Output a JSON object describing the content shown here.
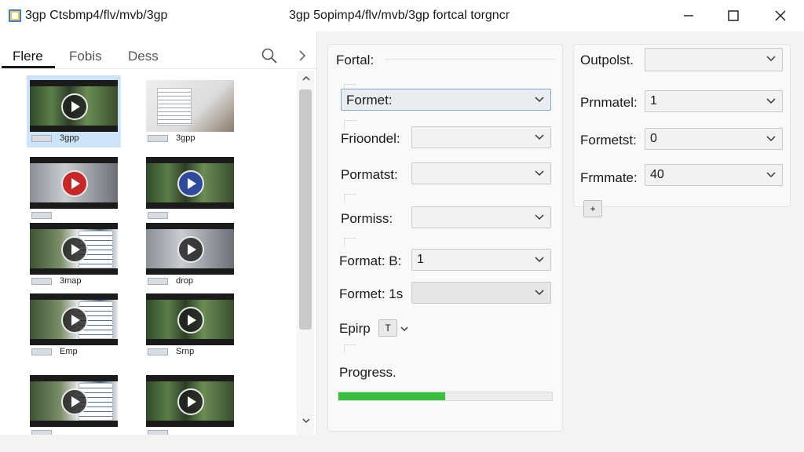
{
  "window": {
    "title_left": "3gp Ctsbmp4/flv/mvb/3gp",
    "title_center": "3gp 5opimp4/flv/mvb/3gp fortcal torgncr"
  },
  "left_panel": {
    "tabs": [
      "Flere",
      "Fobis",
      "Dess"
    ],
    "thumbnails": [
      {
        "caption": "3gpp",
        "scene": "forest",
        "play": "dark"
      },
      {
        "caption": "3gpp",
        "scene": "doc",
        "play": "none"
      },
      {
        "caption": "",
        "scene": "grey",
        "play": "red"
      },
      {
        "caption": "",
        "scene": "forest",
        "play": "blue"
      },
      {
        "caption": "3map",
        "scene": "mixed",
        "play": "dark"
      },
      {
        "caption": "drop",
        "scene": "grey",
        "play": "dark"
      },
      {
        "caption": "Emp",
        "scene": "mixed",
        "play": "dark"
      },
      {
        "caption": "Srnp",
        "scene": "forest",
        "play": "dark"
      },
      {
        "caption": "",
        "scene": "mixed",
        "play": "dark"
      },
      {
        "caption": "",
        "scene": "forest",
        "play": "dark"
      }
    ]
  },
  "format_panel": {
    "title": "Fortal:",
    "fields": [
      {
        "label": "Formet:",
        "value": ""
      },
      {
        "label": "Frioondel:",
        "value": ""
      },
      {
        "label": "Pormatst:",
        "value": ""
      },
      {
        "label": "Pormiss:",
        "value": ""
      },
      {
        "label": "Format: B:",
        "value": "1"
      },
      {
        "label": "Formet: 1s",
        "value": ""
      }
    ],
    "epirp": {
      "label": "Epirp",
      "button": "T"
    },
    "progress": {
      "label": "Progress.",
      "value": 0.5
    }
  },
  "output_panel": {
    "fields": [
      {
        "label": "Outpolst.",
        "value": ""
      },
      {
        "label": "Prnmatel:",
        "value": "1"
      },
      {
        "label": "Formetst:",
        "value": "0"
      },
      {
        "label": "Frmmate:",
        "value": "40"
      }
    ],
    "add_button": "+"
  },
  "colors": {
    "accent": "#7fa9d6",
    "selection": "#cde3f7",
    "progress": "#37c13f"
  }
}
